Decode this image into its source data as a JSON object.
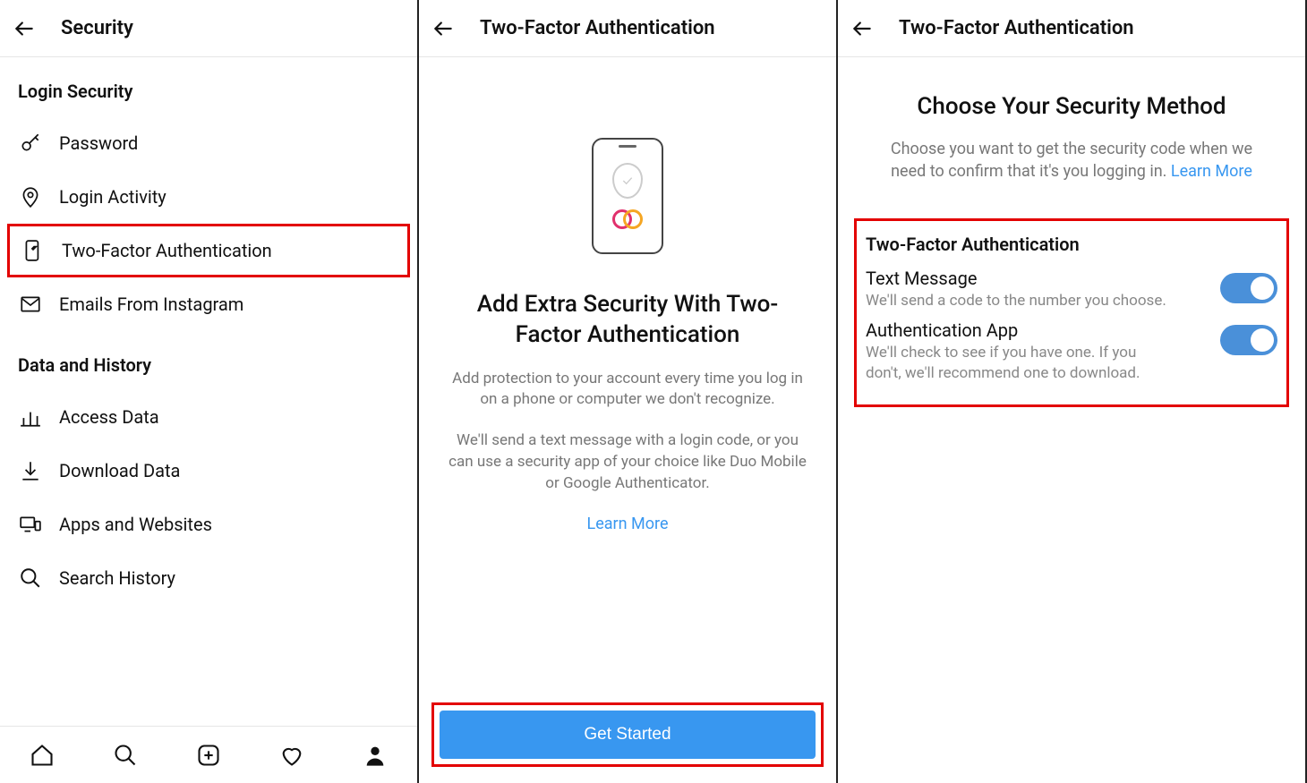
{
  "panel1": {
    "title": "Security",
    "sections": [
      {
        "label": "Login Security",
        "items": [
          {
            "label": "Password",
            "icon": "key-icon"
          },
          {
            "label": "Login Activity",
            "icon": "pin-icon"
          },
          {
            "label": "Two-Factor Authentication",
            "icon": "shield-phone-icon",
            "highlight": true
          },
          {
            "label": "Emails From Instagram",
            "icon": "envelope-icon"
          }
        ]
      },
      {
        "label": "Data and History",
        "items": [
          {
            "label": "Access Data",
            "icon": "bar-chart-icon"
          },
          {
            "label": "Download Data",
            "icon": "download-icon"
          },
          {
            "label": "Apps and Websites",
            "icon": "devices-icon"
          },
          {
            "label": "Search History",
            "icon": "search-icon"
          }
        ]
      }
    ]
  },
  "panel2": {
    "title": "Two-Factor Authentication",
    "heading": "Add Extra Security With Two-Factor Authentication",
    "sub1": "Add protection to your account every time you log in on a phone or computer we don't recognize.",
    "sub2": "We'll send a text message with a login code, or you can use a security app of your choice like Duo Mobile or Google Authenticator.",
    "learn_more": "Learn More",
    "button": "Get Started"
  },
  "panel3": {
    "title": "Two-Factor Authentication",
    "heading": "Choose Your Security Method",
    "sub": "Choose you want to get the security code when we need to confirm that it's you logging in.",
    "learn_more": "Learn More",
    "box_title": "Two-Factor Authentication",
    "methods": [
      {
        "title": "Text Message",
        "desc": "We'll send a code to the number you choose.",
        "on": true
      },
      {
        "title": "Authentication App",
        "desc": "We'll check to see if you have one. If you don't, we'll recommend one to download.",
        "on": true
      }
    ]
  }
}
